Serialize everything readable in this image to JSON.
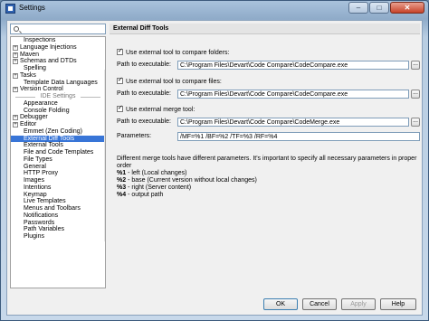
{
  "window": {
    "title": "Settings",
    "minimize": "–",
    "maximize": "□",
    "close": "✕"
  },
  "search": {
    "placeholder": ""
  },
  "tree": {
    "items_top": [
      {
        "label": "Inspections",
        "expandable": false
      },
      {
        "label": "Language Injections",
        "expandable": true
      },
      {
        "label": "Maven",
        "expandable": true
      },
      {
        "label": "Schemas and DTDs",
        "expandable": true
      },
      {
        "label": "Spelling",
        "expandable": false
      },
      {
        "label": "Tasks",
        "expandable": true
      },
      {
        "label": "Template Data Languages",
        "expandable": false
      },
      {
        "label": "Version Control",
        "expandable": true
      }
    ],
    "section_label": "IDE Settings",
    "items_ide": [
      {
        "label": "Appearance",
        "expandable": false
      },
      {
        "label": "Console Folding",
        "expandable": false
      },
      {
        "label": "Debugger",
        "expandable": true
      },
      {
        "label": "Editor",
        "expandable": true
      },
      {
        "label": "Emmet (Zen Coding)",
        "expandable": false
      },
      {
        "label": "External Diff Tools",
        "expandable": false,
        "selected": true
      },
      {
        "label": "External Tools",
        "expandable": false
      },
      {
        "label": "File and Code Templates",
        "expandable": false
      },
      {
        "label": "File Types",
        "expandable": false
      },
      {
        "label": "General",
        "expandable": false
      },
      {
        "label": "HTTP Proxy",
        "expandable": false
      },
      {
        "label": "Images",
        "expandable": false
      },
      {
        "label": "Intentions",
        "expandable": false
      },
      {
        "label": "Keymap",
        "expandable": false
      },
      {
        "label": "Live Templates",
        "expandable": false
      },
      {
        "label": "Menus and Toolbars",
        "expandable": false
      },
      {
        "label": "Notifications",
        "expandable": false
      },
      {
        "label": "Passwords",
        "expandable": false
      },
      {
        "label": "Path Variables",
        "expandable": false
      },
      {
        "label": "Plugins",
        "expandable": false
      }
    ]
  },
  "panel": {
    "title": "External Diff Tools",
    "folders": {
      "checkbox_label": "Use external tool to compare folders:",
      "checked": true,
      "path_label": "Path to executable:",
      "path_value": "C:\\Program Files\\Devart\\Code Compare\\CodeCompare.exe"
    },
    "files": {
      "checkbox_label": "Use external tool to compare files:",
      "checked": true,
      "path_label": "Path to executable:",
      "path_value": "C:\\Program Files\\Devart\\Code Compare\\CodeCompare.exe"
    },
    "merge": {
      "checkbox_label": "Use external merge tool:",
      "checked": true,
      "path_label": "Path to executable:",
      "path_value": "C:\\Program Files\\Devart\\Code Compare\\CodeMerge.exe"
    },
    "parameters": {
      "label": "Parameters:",
      "value": " /MF=%1 /BF=%2 /TF=%3 /RF=%4"
    },
    "browse_label": "...",
    "description": {
      "intro": "Different merge tools have different parameters. It's important to specify all necessary parameters in proper order",
      "p1_key": "%1",
      "p1_text": " - left (Local changes)",
      "p2_key": "%2",
      "p2_text": " - base (Current version without local changes)",
      "p3_key": "%3",
      "p3_text": " - right (Server content)",
      "p4_key": "%4",
      "p4_text": " - output path"
    }
  },
  "footer": {
    "ok": "OK",
    "cancel": "Cancel",
    "apply": "Apply",
    "help": "Help"
  }
}
